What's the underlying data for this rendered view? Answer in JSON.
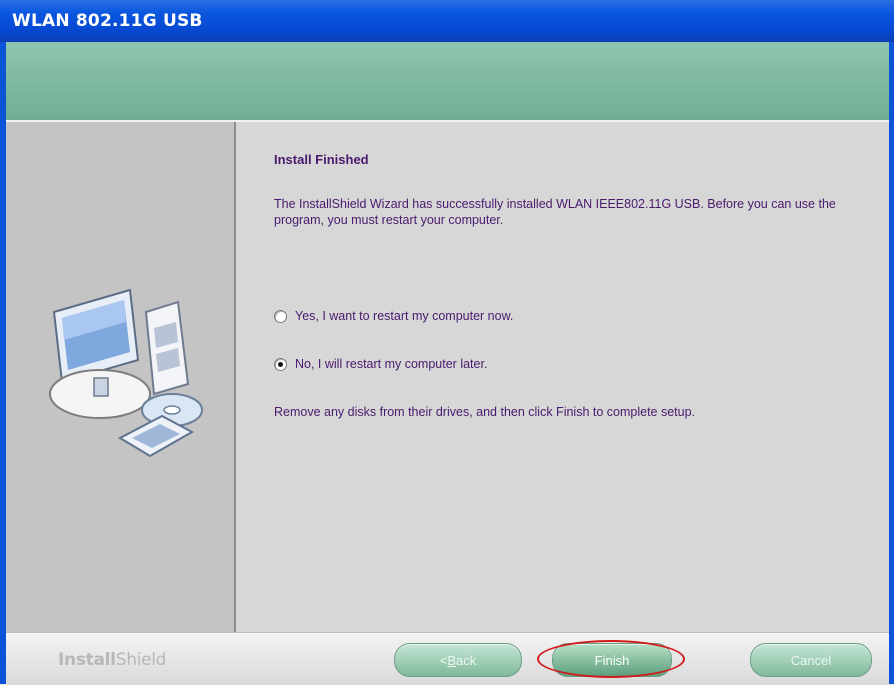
{
  "window": {
    "title": "WLAN 802.11G USB"
  },
  "page": {
    "heading": "Install Finished",
    "intro": "The InstallShield Wizard has successfully installed WLAN  IEEE802.11G USB.  Before you can use the program, you must restart your computer.",
    "options": [
      {
        "label": "Yes, I want to restart my computer now.",
        "selected": false
      },
      {
        "label": "No, I will restart my computer later.",
        "selected": true
      }
    ],
    "note": "Remove any disks from their drives, and then click Finish to complete setup."
  },
  "footer": {
    "brand_bold": "Install",
    "brand_light": "Shield",
    "back_prefix": "< ",
    "back_mnemonic": "B",
    "back_rest": "ack",
    "finish_label": "Finish",
    "cancel_label": "Cancel"
  },
  "colors": {
    "accent_text": "#4a1a6e",
    "titlebar": "#0a57e0",
    "banner": "#7fb8a0",
    "highlight": "#d11a1a"
  }
}
